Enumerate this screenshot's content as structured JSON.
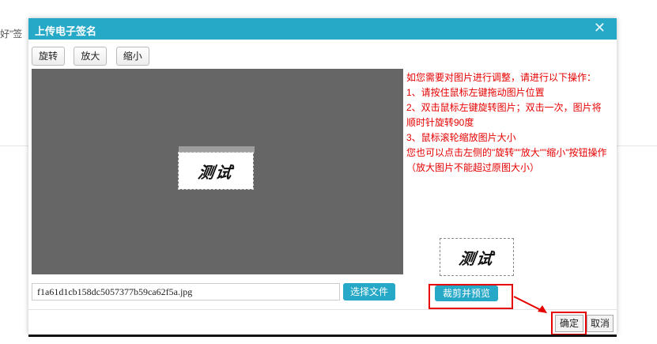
{
  "background": {
    "text": "好\"签"
  },
  "dialog": {
    "title": "上传电子签名",
    "close_label": "✕",
    "toolbar": {
      "rotate": "旋转",
      "zoom_in": "放大",
      "zoom_out": "缩小"
    },
    "signature_text": "测试",
    "instructions": [
      "如您需要对图片进行调整，请进行以下操作：",
      "1、请按住鼠标左键拖动图片位置",
      "2、双击鼠标左键旋转图片；双击一次，图片将顺时针旋转90度",
      "3、鼠标滚轮缩放图片大小",
      "您也可以点击左侧的\"旋转\"\"放大\"\"缩小\"按钮操作（放大图片不能超过原图大小）"
    ],
    "file_name": "f1a61d1cb158dc5057377b59ca62f5a.jpg",
    "choose_file": "选择文件",
    "crop_preview": "裁剪并预览",
    "ok": "确定",
    "cancel": "取消"
  },
  "colors": {
    "accent": "#26a8c7",
    "highlight": "#e60000",
    "canvas": "#666666"
  }
}
